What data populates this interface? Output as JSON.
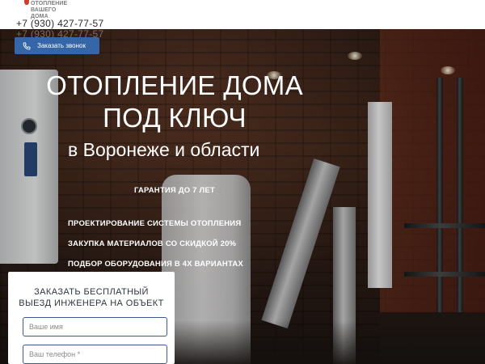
{
  "header": {
    "logo_lines": [
      "ОТОПЛЕНИЕ",
      "ВАШЕГО",
      "ДОМА"
    ],
    "phone": "+7 (930) 427-77-57"
  },
  "hero": {
    "phone_ghost": "+7 (930) 427-77-57",
    "callback_label": "Заказать звонок",
    "title_line1": "ОТОПЛЕНИЕ ДОМА",
    "title_line2": "ПОД КЛЮЧ",
    "subtitle": "в Воронеже и области",
    "guarantee": "ГАРАНТИЯ ДО 7 ЛЕТ",
    "features": [
      "ПРОЕКТИРОВАНИЕ СИСТЕМЫ ОТОПЛЕНИЯ",
      "ЗАКУПКА МАТЕРИАЛОВ СО СКИДКОЙ 20%",
      "ПОДБОР ОБОРУДОВАНИЯ В 4Х ВАРИАНТАХ"
    ]
  },
  "form": {
    "title_line1": "ЗАКАЗАТЬ БЕСПЛАТНЫЙ",
    "title_line2": "ВЫЕЗД ИНЖЕНЕРА НА ОБЪЕКТ",
    "name_placeholder": "Ваше имя",
    "phone_placeholder": "Ваш телефон *"
  },
  "colors": {
    "accent_button": "#3566a8",
    "field_border": "#3d5b8f",
    "logo_red": "#d23a2a"
  },
  "icons": {
    "callback": "phone-icon",
    "logo": "flame-logo-icon"
  }
}
